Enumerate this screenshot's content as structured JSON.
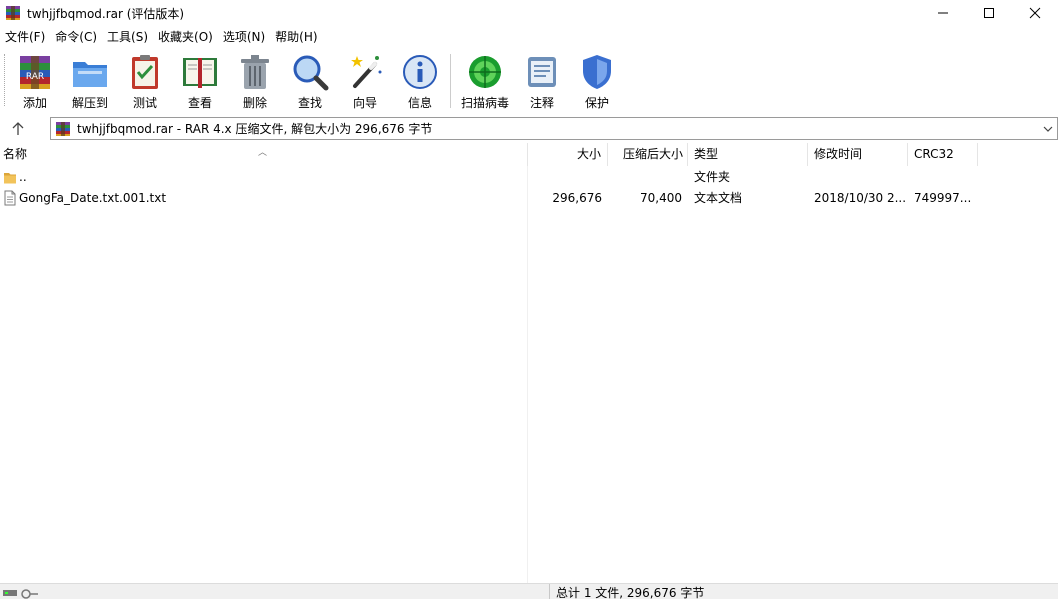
{
  "window": {
    "title": "twhjjfbqmod.rar (评估版本)",
    "controls": {
      "minimize": "minimize-icon",
      "maximize": "maximize-icon",
      "close": "close-icon"
    }
  },
  "menu": [
    "文件(F)",
    "命令(C)",
    "工具(S)",
    "收藏夹(O)",
    "选项(N)",
    "帮助(H)"
  ],
  "toolbar": {
    "add": "添加",
    "extract": "解压到",
    "test": "测试",
    "view": "查看",
    "delete": "删除",
    "find": "查找",
    "wizard": "向导",
    "info": "信息",
    "scan": "扫描病毒",
    "comment": "注释",
    "protect": "保护"
  },
  "address": {
    "text": "twhjjfbqmod.rar - RAR 4.x 压缩文件, 解包大小为 296,676 字节"
  },
  "columns": {
    "name": "名称",
    "size": "大小",
    "packed": "压缩后大小",
    "type": "类型",
    "modified": "修改时间",
    "crc": "CRC32"
  },
  "rows": [
    {
      "name": "..",
      "size": "",
      "packed": "",
      "type": "文件夹",
      "modified": "",
      "crc": ""
    },
    {
      "name": "GongFa_Date.txt.001.txt",
      "size": "296,676",
      "packed": "70,400",
      "type": "文本文档",
      "modified": "2018/10/30 2...",
      "crc": "749997..."
    }
  ],
  "status": {
    "summary": "总计 1 文件, 296,676 字节"
  },
  "colors": {
    "accent_green": "#1a9d2e",
    "folder_yellow": "#f2c35a",
    "rar_red": "#b3262c"
  }
}
